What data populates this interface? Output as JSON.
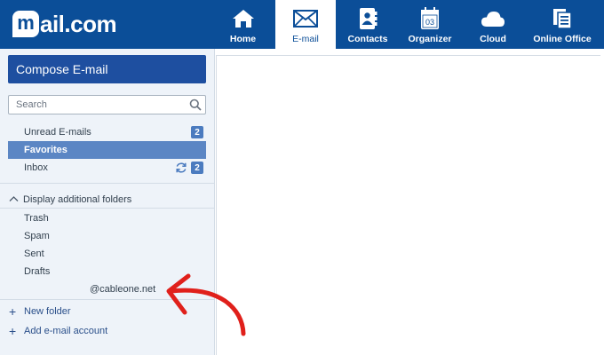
{
  "brand": {
    "logo_mark": "m",
    "logo_text": "ail.com"
  },
  "nav": {
    "home": {
      "label": "Home",
      "icon": "home-icon"
    },
    "email": {
      "label": "E-mail",
      "icon": "envelope-icon"
    },
    "contacts": {
      "label": "Contacts",
      "icon": "contacts-icon"
    },
    "organizer": {
      "label": "Organizer",
      "icon": "calendar-icon",
      "day": "03"
    },
    "cloud": {
      "label": "Cloud",
      "icon": "cloud-icon"
    },
    "office": {
      "label": "Online Office",
      "icon": "office-icon"
    }
  },
  "sidebar": {
    "compose_label": "Compose E-mail",
    "search_placeholder": "Search",
    "unread": {
      "label": "Unread E-mails",
      "count": "2"
    },
    "favorites": {
      "label": "Favorites"
    },
    "inbox": {
      "label": "Inbox",
      "count": "2"
    },
    "additional_toggle": "Display additional folders",
    "folders": [
      "Trash",
      "Spam",
      "Sent",
      "Drafts"
    ],
    "account": "@cableone.net",
    "new_folder": "New folder",
    "add_account": "Add e-mail account"
  },
  "colors": {
    "brand": "#0b4e98",
    "selected": "#5b86c4",
    "annotation": "#e0201b"
  }
}
